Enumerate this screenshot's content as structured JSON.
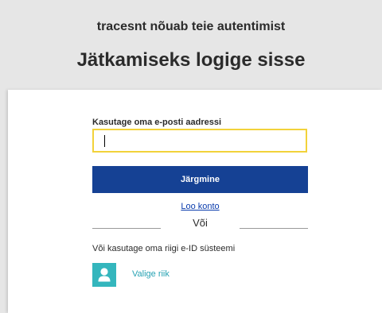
{
  "header": {
    "subtitle": "tracesnt nõuab teie autentimist",
    "title": "Jätkamiseks logige sisse"
  },
  "form": {
    "email_label": "Kasutage oma e-posti aadressi",
    "email_value": "",
    "next_button": "Järgmine",
    "create_account_link": "Loo konto",
    "divider_text": "Või",
    "eid_text": "Või kasutage oma riigi e-ID süsteemi",
    "country_button": {
      "label": "Valige riik",
      "icon": "person-icon"
    }
  },
  "colors": {
    "primary_button": "#154194",
    "input_focus_border": "#f2d23a",
    "link": "#0a3cad",
    "accent_teal": "#34b6bd"
  }
}
